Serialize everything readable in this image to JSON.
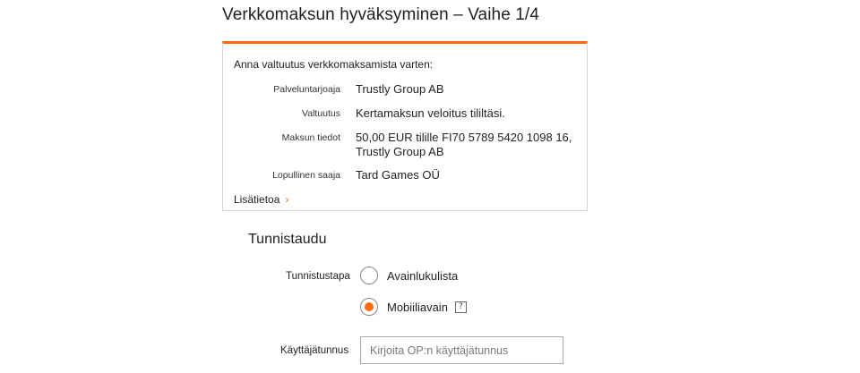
{
  "page": {
    "title": "Verkkomaksun hyväksyminen – Vaihe 1/4"
  },
  "authorization": {
    "intro": "Anna valtuutus verkkomaksamista varten:",
    "rows": [
      {
        "label": "Palveluntarjoaja",
        "value": "Trustly Group AB"
      },
      {
        "label": "Valtuutus",
        "value": "Kertamaksun veloitus tililtäsi."
      },
      {
        "label": "Maksun tiedot",
        "value_line1": "50,00 EUR tilille FI70 5789 5420 1098 16,",
        "value_line2": "Trustly Group AB"
      },
      {
        "label": "Lopullinen saaja",
        "value": "Tard Games OÜ"
      }
    ],
    "more_link": "Lisätietoa",
    "more_link_icon": "chevron-right-icon"
  },
  "identify": {
    "section_title": "Tunnistaudu",
    "method_label": "Tunnistustapa",
    "options": [
      {
        "label": "Avainlukulista",
        "selected": false
      },
      {
        "label": "Mobiiliavain",
        "selected": true
      }
    ],
    "help_glyph": "?",
    "username_label": "Käyttäjätunnus",
    "username_placeholder": "Kirjoita OP:n käyttäjätunnus",
    "username_value": ""
  },
  "colors": {
    "accent": "#ff6a10",
    "border": "#d6d6d6",
    "text": "#222222"
  }
}
